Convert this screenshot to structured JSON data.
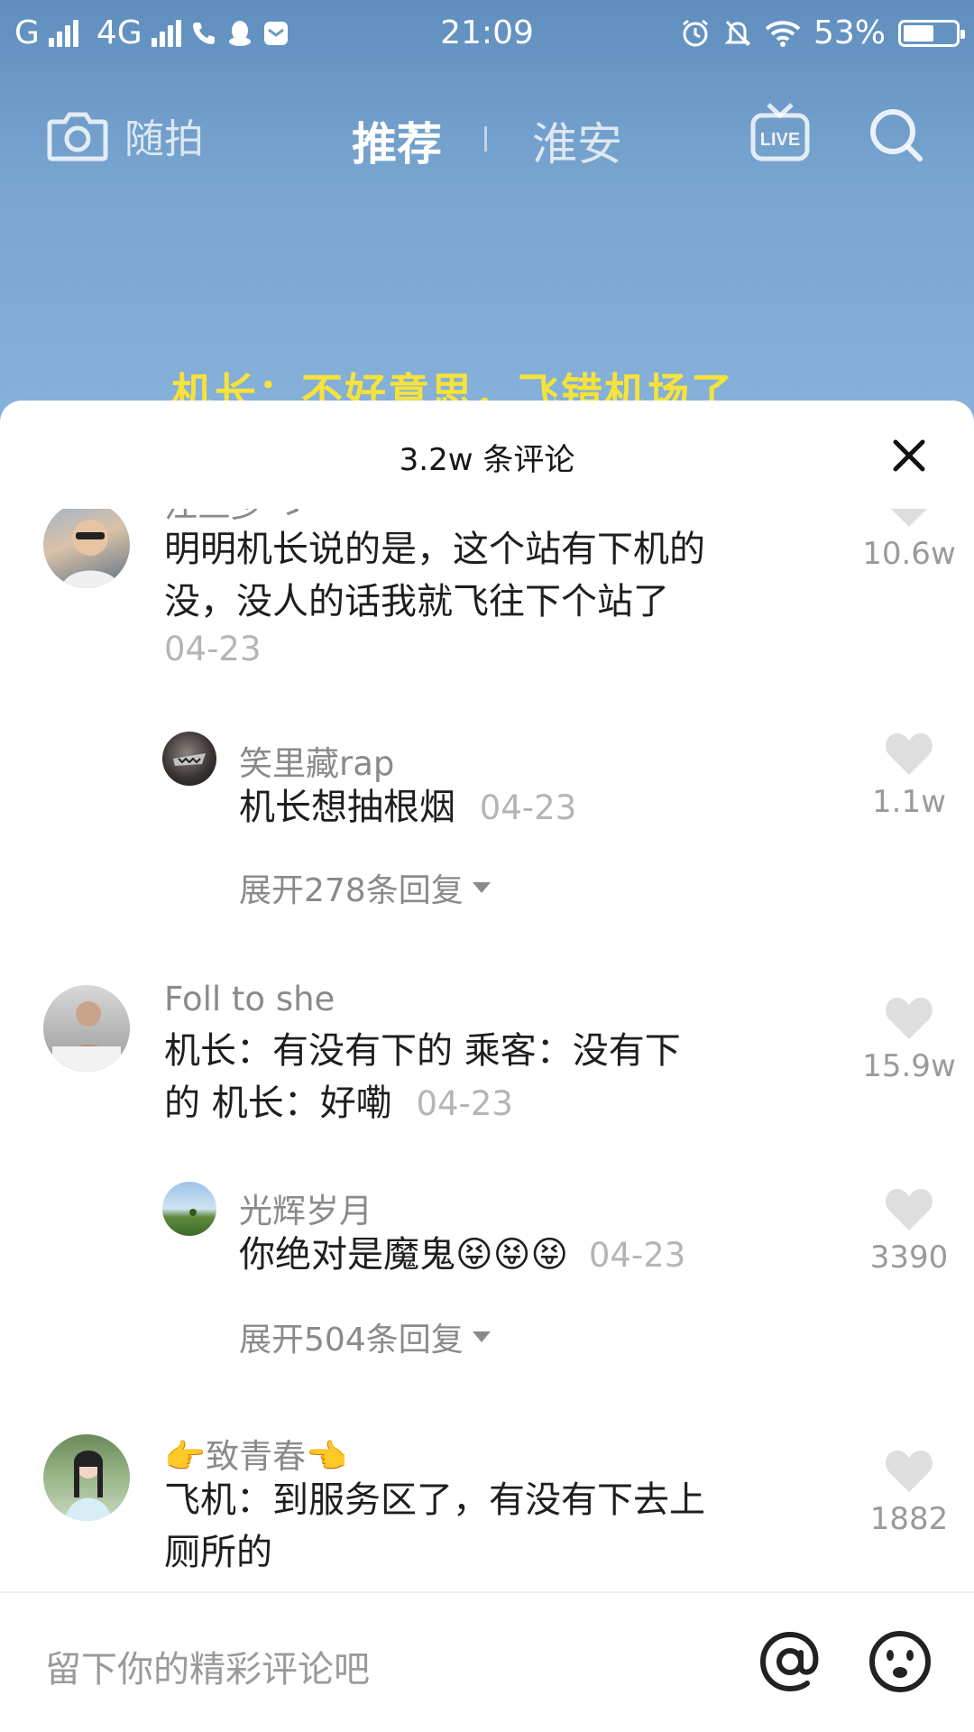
{
  "status_bar": {
    "network_left": "G",
    "network_4g": "4G",
    "time": "21:09",
    "battery": "53%"
  },
  "top_nav": {
    "camera_label": "随拍",
    "tab_recommend": "推荐",
    "tab_local": "淮安"
  },
  "video": {
    "caption": "机长：不好意思，飞错机场了"
  },
  "comments_sheet": {
    "title": "3.2w 条评论",
    "input_placeholder": "留下你的精彩评论吧",
    "comments": [
      {
        "name": "江三少 ゞ",
        "text_line1": "明明机长说的是，这个站有下机的",
        "text_line2": "没，没人的话我就飞往下个站了",
        "date": "04-23",
        "likes": "10.6w",
        "reply": {
          "name": "笑里藏rap",
          "text": "机长想抽根烟",
          "date": "04-23",
          "likes": "1.1w"
        },
        "expand_label": "展开278条回复"
      },
      {
        "name": "Foll to she",
        "text_line1": "机长：有没有下的 乘客：没有下",
        "text_line2": "的 机长：好嘞",
        "date": "04-23",
        "likes": "15.9w",
        "reply": {
          "name": "光辉岁月",
          "text": "你绝对是魔鬼",
          "emoji": "😝😝😝",
          "date": "04-23",
          "likes": "3390"
        },
        "expand_label": "展开504条回复"
      },
      {
        "name": "致青春",
        "name_emoji_left": "👉",
        "name_emoji_right": "👈",
        "text_line1": "飞机：到服务区了，有没有下去上",
        "text_line2": "厕所的",
        "likes": "1882"
      }
    ]
  },
  "colors": {
    "video_bg_top": "#5f8ebd",
    "caption_yellow": "#f6e23a",
    "like_heart": "#dedede"
  }
}
